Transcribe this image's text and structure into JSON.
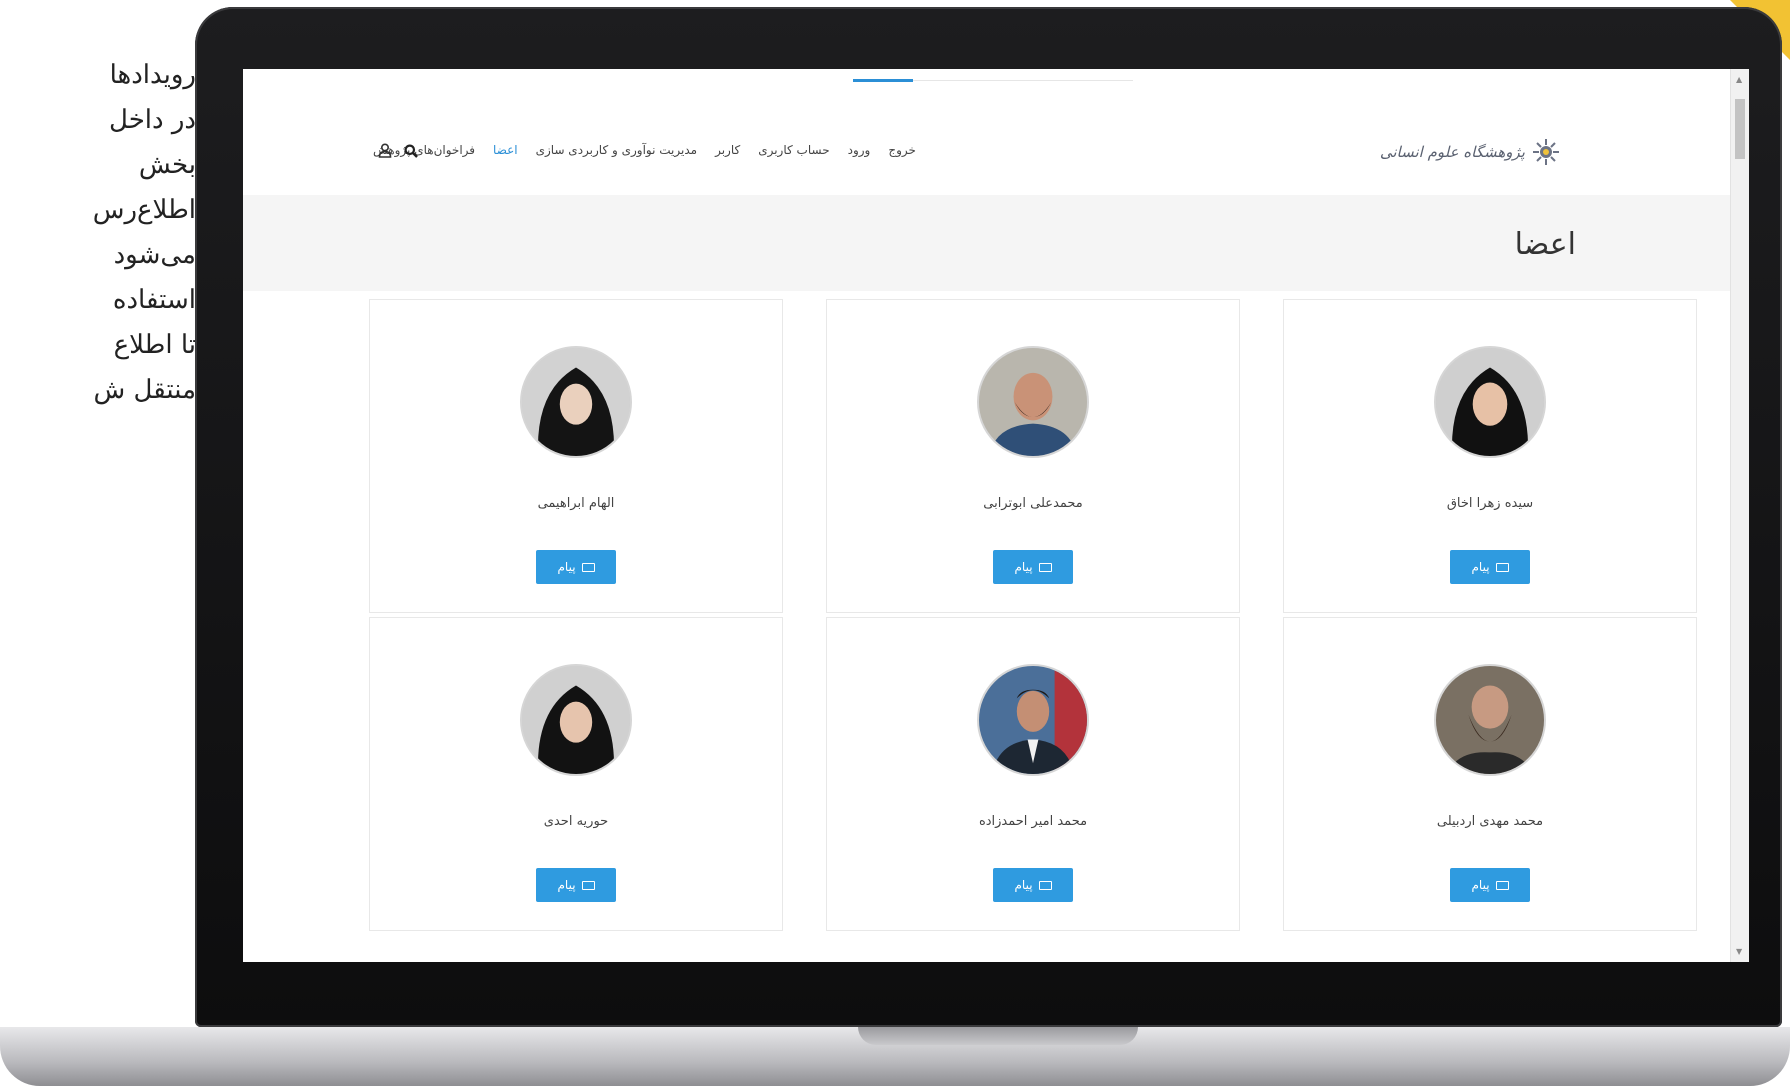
{
  "side_text": {
    "lines": [
      "رویدادها",
      "در داخل",
      "بخش",
      "اطلاع‌رس",
      "می‌شود",
      "استفاده",
      "تا اطلاع",
      "منتقل ش"
    ]
  },
  "header": {
    "logo_text": "پژوهشگاه علوم انسانی",
    "nav": [
      {
        "label": "فراخوان‌های پژوهش",
        "active": false
      },
      {
        "label": "اعضا",
        "active": true
      },
      {
        "label": "مدیریت نوآوری و کاربردی سازی",
        "active": false
      },
      {
        "label": "کاربر",
        "active": false
      },
      {
        "label": "حساب کاربری",
        "active": false
      },
      {
        "label": "ورود",
        "active": false
      },
      {
        "label": "خروج",
        "active": false
      }
    ],
    "icons": [
      "search-icon",
      "user-icon"
    ]
  },
  "page": {
    "title": "اعضا"
  },
  "members": [
    {
      "name": "سیده زهرا اخاق",
      "button": "پیام",
      "avatar": "female"
    },
    {
      "name": "محمدعلی ابوترابی",
      "button": "پیام",
      "avatar": "male"
    },
    {
      "name": "الهام ابراهیمی",
      "button": "پیام",
      "avatar": "female"
    },
    {
      "name": "محمد مهدی اردبیلی",
      "button": "پیام",
      "avatar": "male-beard"
    },
    {
      "name": "محمد امیر احمدزاده",
      "button": "پیام",
      "avatar": "male-suit"
    },
    {
      "name": "حوریه احدی",
      "button": "پیام",
      "avatar": "female"
    }
  ],
  "colors": {
    "accent": "#2f9be0",
    "active_nav": "#2b8fd6",
    "title_band": "#f5f5f5"
  }
}
